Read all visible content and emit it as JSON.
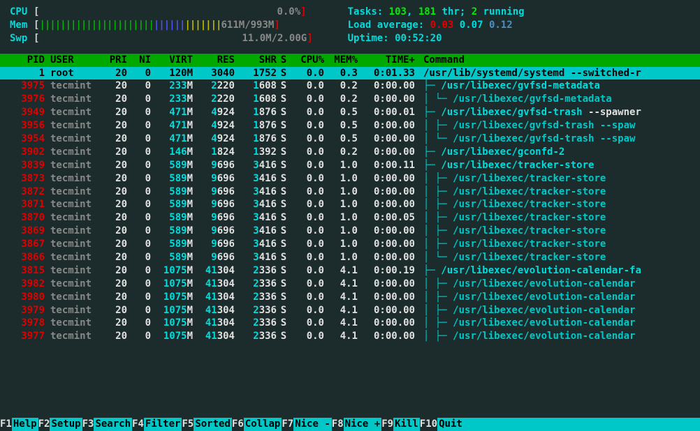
{
  "header": {
    "cpu_label": "CPU",
    "cpu_pct": "0.0%",
    "mem_label": "Mem",
    "mem_used": "611M",
    "mem_total": "993M",
    "swp_label": "Swp",
    "swp_used": "11.0M",
    "swp_total": "2.00G",
    "tasks_label": "Tasks:",
    "tasks_n": "103",
    "threads_n": "181",
    "thr_lbl": "thr;",
    "running_n": "2",
    "running_lbl": "running",
    "load_label": "Load average:",
    "load1": "0.03",
    "load5": "0.07",
    "load15": "0.12",
    "uptime_label": "Uptime:",
    "uptime": "00:52:20"
  },
  "columns": {
    "pid": "PID",
    "user": "USER",
    "pri": "PRI",
    "ni": "NI",
    "virt": "VIRT",
    "res": "RES",
    "shr": "SHR",
    "s": "S",
    "cpu": "CPU%",
    "mem": "MEM%",
    "time": "TIME+",
    "cmd": "Command"
  },
  "selected": {
    "pid": "1",
    "user": "root",
    "pri": "20",
    "ni": "0",
    "virt": "120M",
    "res": "3040",
    "shr": "1752",
    "s": "S",
    "cpu": "0.0",
    "mem": "0.3",
    "time": "0:01.33",
    "cmd": "/usr/lib/systemd/systemd --switched-r"
  },
  "rows": [
    {
      "pid": "3975",
      "user": "tecmint",
      "pri": "20",
      "ni": "0",
      "virtn": "233",
      "virtu": "M",
      "res1": "2",
      "res2": "220",
      "shr1": "1",
      "shr2": "608",
      "s": "S",
      "cpu": "0.0",
      "mem": "0.2",
      "time": "0:00.00",
      "tree": "├─ ",
      "child": false,
      "cmd": "/usr/libexec/gvfsd-metadata",
      "arg": ""
    },
    {
      "pid": "3976",
      "user": "tecmint",
      "pri": "20",
      "ni": "0",
      "virtn": "233",
      "virtu": "M",
      "res1": "2",
      "res2": "220",
      "shr1": "1",
      "shr2": "608",
      "s": "S",
      "cpu": "0.0",
      "mem": "0.2",
      "time": "0:00.00",
      "tree": "│  └─ ",
      "child": true,
      "cmd": "/usr/libexec/gvfsd-metadata",
      "arg": ""
    },
    {
      "pid": "3949",
      "user": "tecmint",
      "pri": "20",
      "ni": "0",
      "virtn": "471",
      "virtu": "M",
      "res1": "4",
      "res2": "924",
      "shr1": "1",
      "shr2": "876",
      "s": "S",
      "cpu": "0.0",
      "mem": "0.5",
      "time": "0:00.01",
      "tree": "├─ ",
      "child": false,
      "cmd": "/usr/libexec/gvfsd-trash",
      "arg": " --spawner"
    },
    {
      "pid": "3956",
      "user": "tecmint",
      "pri": "20",
      "ni": "0",
      "virtn": "471",
      "virtu": "M",
      "res1": "4",
      "res2": "924",
      "shr1": "1",
      "shr2": "876",
      "s": "S",
      "cpu": "0.0",
      "mem": "0.5",
      "time": "0:00.00",
      "tree": "│  ├─ ",
      "child": true,
      "cmd": "/usr/libexec/gvfsd-trash --spaw",
      "arg": ""
    },
    {
      "pid": "3954",
      "user": "tecmint",
      "pri": "20",
      "ni": "0",
      "virtn": "471",
      "virtu": "M",
      "res1": "4",
      "res2": "924",
      "shr1": "1",
      "shr2": "876",
      "s": "S",
      "cpu": "0.0",
      "mem": "0.5",
      "time": "0:00.00",
      "tree": "│  └─ ",
      "child": true,
      "cmd": "/usr/libexec/gvfsd-trash --spaw",
      "arg": ""
    },
    {
      "pid": "3902",
      "user": "tecmint",
      "pri": "20",
      "ni": "0",
      "virtn": "146",
      "virtu": "M",
      "res1": "1",
      "res2": "824",
      "shr1": "1",
      "shr2": "392",
      "s": "S",
      "cpu": "0.0",
      "mem": "0.2",
      "time": "0:00.00",
      "tree": "├─ ",
      "child": false,
      "cmd": "/usr/libexec/gconfd-2",
      "arg": ""
    },
    {
      "pid": "3839",
      "user": "tecmint",
      "pri": "20",
      "ni": "0",
      "virtn": "589",
      "virtu": "M",
      "res1": "9",
      "res2": "696",
      "shr1": "3",
      "shr2": "416",
      "s": "S",
      "cpu": "0.0",
      "mem": "1.0",
      "time": "0:00.11",
      "tree": "├─ ",
      "child": false,
      "cmd": "/usr/libexec/tracker-store",
      "arg": ""
    },
    {
      "pid": "3873",
      "user": "tecmint",
      "pri": "20",
      "ni": "0",
      "virtn": "589",
      "virtu": "M",
      "res1": "9",
      "res2": "696",
      "shr1": "3",
      "shr2": "416",
      "s": "S",
      "cpu": "0.0",
      "mem": "1.0",
      "time": "0:00.00",
      "tree": "│  ├─ ",
      "child": true,
      "cmd": "/usr/libexec/tracker-store",
      "arg": ""
    },
    {
      "pid": "3872",
      "user": "tecmint",
      "pri": "20",
      "ni": "0",
      "virtn": "589",
      "virtu": "M",
      "res1": "9",
      "res2": "696",
      "shr1": "3",
      "shr2": "416",
      "s": "S",
      "cpu": "0.0",
      "mem": "1.0",
      "time": "0:00.00",
      "tree": "│  ├─ ",
      "child": true,
      "cmd": "/usr/libexec/tracker-store",
      "arg": ""
    },
    {
      "pid": "3871",
      "user": "tecmint",
      "pri": "20",
      "ni": "0",
      "virtn": "589",
      "virtu": "M",
      "res1": "9",
      "res2": "696",
      "shr1": "3",
      "shr2": "416",
      "s": "S",
      "cpu": "0.0",
      "mem": "1.0",
      "time": "0:00.00",
      "tree": "│  ├─ ",
      "child": true,
      "cmd": "/usr/libexec/tracker-store",
      "arg": ""
    },
    {
      "pid": "3870",
      "user": "tecmint",
      "pri": "20",
      "ni": "0",
      "virtn": "589",
      "virtu": "M",
      "res1": "9",
      "res2": "696",
      "shr1": "3",
      "shr2": "416",
      "s": "S",
      "cpu": "0.0",
      "mem": "1.0",
      "time": "0:00.05",
      "tree": "│  ├─ ",
      "child": true,
      "cmd": "/usr/libexec/tracker-store",
      "arg": ""
    },
    {
      "pid": "3869",
      "user": "tecmint",
      "pri": "20",
      "ni": "0",
      "virtn": "589",
      "virtu": "M",
      "res1": "9",
      "res2": "696",
      "shr1": "3",
      "shr2": "416",
      "s": "S",
      "cpu": "0.0",
      "mem": "1.0",
      "time": "0:00.00",
      "tree": "│  ├─ ",
      "child": true,
      "cmd": "/usr/libexec/tracker-store",
      "arg": ""
    },
    {
      "pid": "3867",
      "user": "tecmint",
      "pri": "20",
      "ni": "0",
      "virtn": "589",
      "virtu": "M",
      "res1": "9",
      "res2": "696",
      "shr1": "3",
      "shr2": "416",
      "s": "S",
      "cpu": "0.0",
      "mem": "1.0",
      "time": "0:00.00",
      "tree": "│  ├─ ",
      "child": true,
      "cmd": "/usr/libexec/tracker-store",
      "arg": ""
    },
    {
      "pid": "3866",
      "user": "tecmint",
      "pri": "20",
      "ni": "0",
      "virtn": "589",
      "virtu": "M",
      "res1": "9",
      "res2": "696",
      "shr1": "3",
      "shr2": "416",
      "s": "S",
      "cpu": "0.0",
      "mem": "1.0",
      "time": "0:00.00",
      "tree": "│  └─ ",
      "child": true,
      "cmd": "/usr/libexec/tracker-store",
      "arg": ""
    },
    {
      "pid": "3815",
      "user": "tecmint",
      "pri": "20",
      "ni": "0",
      "virtn": "1075",
      "virtu": "M",
      "res1": "41",
      "res2": "304",
      "shr1": "2",
      "shr2": "336",
      "s": "S",
      "cpu": "0.0",
      "mem": "4.1",
      "time": "0:00.19",
      "tree": "├─ ",
      "child": false,
      "cmd": "/usr/libexec/evolution-calendar-fa",
      "arg": ""
    },
    {
      "pid": "3982",
      "user": "tecmint",
      "pri": "20",
      "ni": "0",
      "virtn": "1075",
      "virtu": "M",
      "res1": "41",
      "res2": "304",
      "shr1": "2",
      "shr2": "336",
      "s": "S",
      "cpu": "0.0",
      "mem": "4.1",
      "time": "0:00.00",
      "tree": "│  ├─ ",
      "child": true,
      "cmd": "/usr/libexec/evolution-calendar",
      "arg": ""
    },
    {
      "pid": "3980",
      "user": "tecmint",
      "pri": "20",
      "ni": "0",
      "virtn": "1075",
      "virtu": "M",
      "res1": "41",
      "res2": "304",
      "shr1": "2",
      "shr2": "336",
      "s": "S",
      "cpu": "0.0",
      "mem": "4.1",
      "time": "0:00.00",
      "tree": "│  ├─ ",
      "child": true,
      "cmd": "/usr/libexec/evolution-calendar",
      "arg": ""
    },
    {
      "pid": "3979",
      "user": "tecmint",
      "pri": "20",
      "ni": "0",
      "virtn": "1075",
      "virtu": "M",
      "res1": "41",
      "res2": "304",
      "shr1": "2",
      "shr2": "336",
      "s": "S",
      "cpu": "0.0",
      "mem": "4.1",
      "time": "0:00.00",
      "tree": "│  ├─ ",
      "child": true,
      "cmd": "/usr/libexec/evolution-calendar",
      "arg": ""
    },
    {
      "pid": "3978",
      "user": "tecmint",
      "pri": "20",
      "ni": "0",
      "virtn": "1075",
      "virtu": "M",
      "res1": "41",
      "res2": "304",
      "shr1": "2",
      "shr2": "336",
      "s": "S",
      "cpu": "0.0",
      "mem": "4.1",
      "time": "0:00.00",
      "tree": "│  ├─ ",
      "child": true,
      "cmd": "/usr/libexec/evolution-calendar",
      "arg": ""
    },
    {
      "pid": "3977",
      "user": "tecmint",
      "pri": "20",
      "ni": "0",
      "virtn": "1075",
      "virtu": "M",
      "res1": "41",
      "res2": "304",
      "shr1": "2",
      "shr2": "336",
      "s": "S",
      "cpu": "0.0",
      "mem": "4.1",
      "time": "0:00.00",
      "tree": "│  ├─ ",
      "child": true,
      "cmd": "/usr/libexec/evolution-calendar",
      "arg": ""
    }
  ],
  "footer": [
    {
      "k": "F1",
      "a": "Help  "
    },
    {
      "k": "F2",
      "a": "Setup "
    },
    {
      "k": "F3",
      "a": "Search"
    },
    {
      "k": "F4",
      "a": "Filter"
    },
    {
      "k": "F5",
      "a": "Sorted"
    },
    {
      "k": "F6",
      "a": "Collap"
    },
    {
      "k": "F7",
      "a": "Nice -"
    },
    {
      "k": "F8",
      "a": "Nice +"
    },
    {
      "k": "F9",
      "a": "Kill  "
    },
    {
      "k": "F10",
      "a": "Quit  "
    }
  ]
}
